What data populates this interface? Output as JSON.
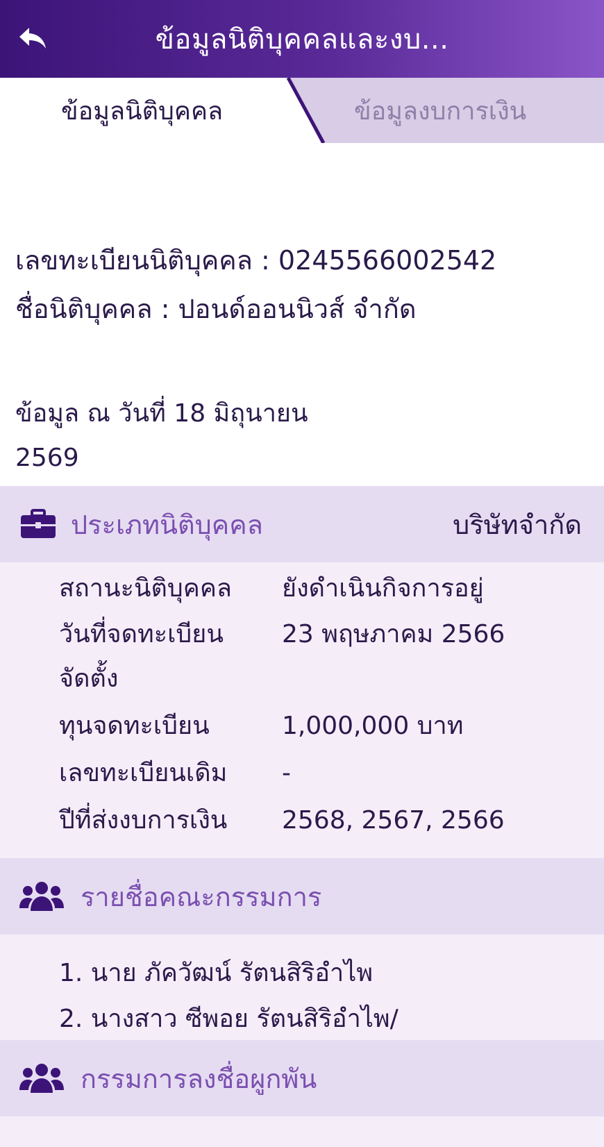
{
  "header": {
    "title": "ข้อมูลนิติบุคคลและงบ...",
    "back_icon": "reply-arrow-icon"
  },
  "tabs": [
    {
      "label": "ข้อมูลนิติบุคคล",
      "active": true
    },
    {
      "label": "ข้อมูลงบการเงิน",
      "active": false
    }
  ],
  "registration": {
    "number_line": "เลขทะเบียนนิติบุคคล : 0245566002542",
    "name_line": "ชื่อนิติบุคคล : ปอนด์ออนนิวส์ จำกัด"
  },
  "as_of": {
    "line1": "ข้อมูล ณ วันที่ 18 มิถุนายน",
    "line2": "2569"
  },
  "type_section": {
    "icon": "briefcase-icon",
    "title": "ประเภทนิติบุคคล",
    "value": "บริษัทจำกัด"
  },
  "details": [
    {
      "label": "สถานะนิติบุคคล",
      "value": "ยังดำเนินกิจการอยู่"
    },
    {
      "label_line1": "วันที่จดทะเบียน",
      "label_line2": "จัดตั้ง",
      "value": "23 พฤษภาคม 2566"
    },
    {
      "label": "ทุนจดทะเบียน",
      "value": "1,000,000 บาท"
    },
    {
      "label": "เลขทะเบียนเดิม",
      "value": "-"
    },
    {
      "label": "ปีที่ส่งงบการเงิน",
      "value": "2568, 2567, 2566"
    }
  ],
  "directors_section": {
    "icon": "users-group-icon",
    "title": "รายชื่อคณะกรรมการ",
    "items": [
      "1. นาย ภัควัฒน์ รัตนสิริอำไพ",
      "2. นางสาว ซีพอย รัตนสิริอำไพ/"
    ]
  },
  "signing_section": {
    "icon": "users-group-icon",
    "title": "กรรมการลงชื่อผูกพัน"
  },
  "colors": {
    "header_start": "#3c1478",
    "header_end": "#8a55c8",
    "section_head_bg": "#e6dcf2",
    "section_body_bg": "#f5eef9",
    "accent": "#7a4fb0",
    "text": "#2a1a4a"
  }
}
